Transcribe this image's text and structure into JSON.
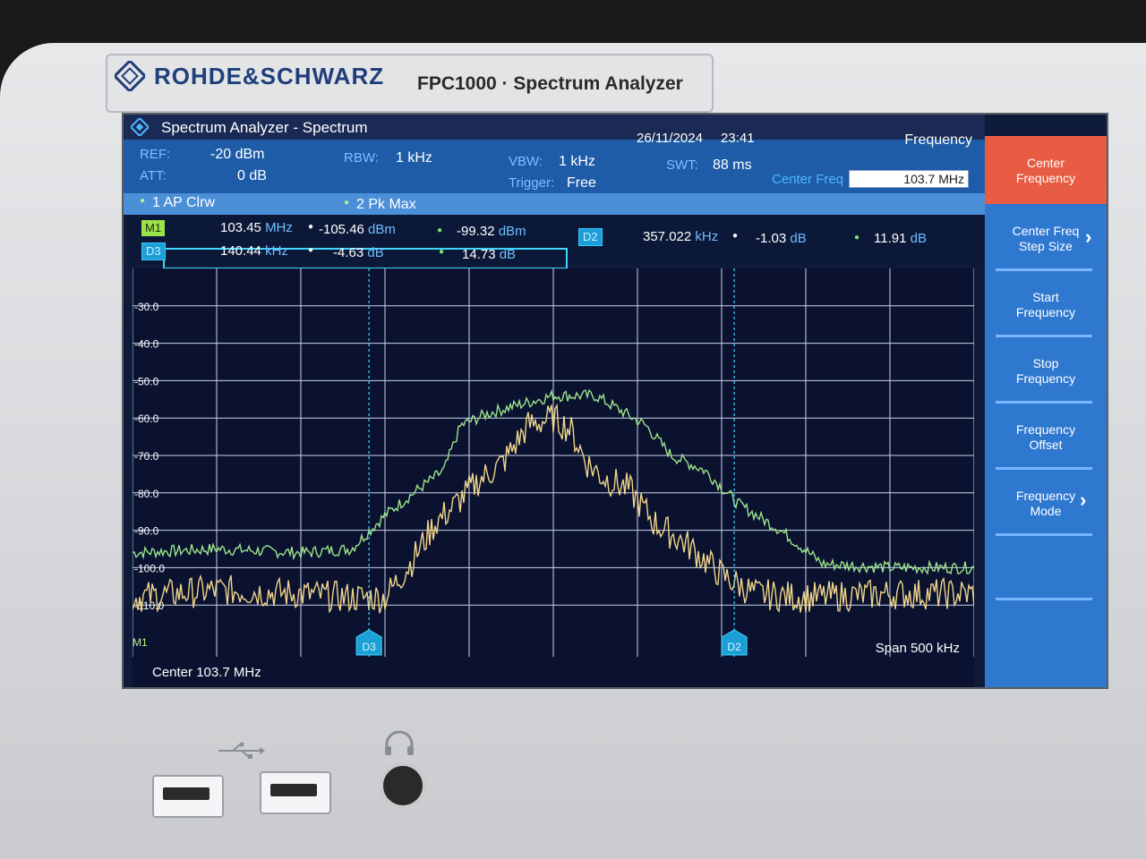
{
  "device": {
    "brand": "ROHDE&SCHWARZ",
    "model": "FPC1000 · Spectrum Analyzer"
  },
  "app": {
    "title": "Spectrum Analyzer - Spectrum",
    "date": "26/11/2024",
    "time": "23:41"
  },
  "params": {
    "ref_label": "REF:",
    "ref_value": "-20 dBm",
    "att_label": "ATT:",
    "att_value": "0 dB",
    "rbw_label": "RBW:",
    "rbw_value": "1 kHz",
    "vbw_label": "VBW:",
    "vbw_value": "1 kHz",
    "trigger_label": "Trigger:",
    "trigger_value": "Free",
    "swt_label": "SWT:",
    "swt_value": "88 ms"
  },
  "frequency_panel": {
    "heading": "Frequency",
    "center_freq_label": "Center Freq",
    "center_freq_value": "103.7 MHz"
  },
  "traces": {
    "t1": "1 AP  Clrw",
    "t2": "2 Pk  Max"
  },
  "markers": {
    "m1": {
      "tag": "M1",
      "freq": "103.45",
      "freq_unit": "MHz",
      "level": "-105.46",
      "level_unit": "dBm",
      "level2": "-99.32",
      "level2_unit": "dBm"
    },
    "d3": {
      "tag": "D3",
      "freq": "140.44",
      "freq_unit": "kHz",
      "level": "-4.63",
      "level_unit": "dB",
      "level2": "14.73",
      "level2_unit": "dB"
    },
    "d2": {
      "tag": "D2",
      "freq": "357.022",
      "freq_unit": "kHz",
      "level": "-1.03",
      "level_unit": "dB",
      "level2": "11.91",
      "level2_unit": "dB"
    }
  },
  "softkeys": [
    {
      "label_1": "Center",
      "label_2": "Frequency",
      "active": true
    },
    {
      "label_1": "Center Freq",
      "label_2": "Step Size",
      "chevron": "›"
    },
    {
      "label_1": "Start",
      "label_2": "Frequency"
    },
    {
      "label_1": "Stop",
      "label_2": "Frequency"
    },
    {
      "label_1": "Frequency",
      "label_2": "Offset"
    },
    {
      "label_1": "Frequency",
      "label_2": "Mode",
      "chevron": "›"
    }
  ],
  "plot_labels": {
    "center": "Center 103.7 MHz",
    "span": "Span 500 kHz",
    "m1_edge": "M1",
    "d3_flag": "D3",
    "d2_flag": "D2"
  },
  "chart_data": {
    "type": "line",
    "x_range_khz": [
      -250,
      250
    ],
    "ylim": [
      -120,
      -20
    ],
    "yticks": [
      "-30.0",
      "-40.0",
      "-50.0",
      "-60.0",
      "-70.0",
      "-80.0",
      "-90.0",
      "-100.0",
      "-110.0"
    ],
    "series": [
      {
        "color": "#9be38a",
        "x": [
          -250,
          -200,
          -150,
          -120,
          -100,
          -80,
          -65,
          -55,
          -40,
          -25,
          0,
          25,
          40,
          55,
          70,
          90,
          110,
          135,
          160,
          200,
          250
        ],
        "y": [
          -96,
          -95,
          -96,
          -95,
          -86,
          -79,
          -74,
          -62,
          -59,
          -57,
          -54,
          -54,
          -58,
          -62,
          -70,
          -74,
          -83,
          -90,
          -99,
          -100,
          -100
        ]
      },
      {
        "color": "#f0d48a",
        "x": [
          -250,
          -200,
          -150,
          -120,
          -100,
          -85,
          -70,
          -60,
          -45,
          -30,
          -15,
          0,
          10,
          20,
          30,
          45,
          60,
          80,
          100,
          120,
          150,
          200,
          250
        ],
        "y": [
          -108,
          -106,
          -107,
          -108,
          -108,
          -99,
          -88,
          -84,
          -77,
          -72,
          -62,
          -60,
          -63,
          -72,
          -76,
          -79,
          -88,
          -94,
          -102,
          -107,
          -108,
          -107,
          -107
        ]
      }
    ]
  },
  "colors": {
    "screen_bg": "#0a1230",
    "param_bar": "#1e5ca8",
    "softkey_active": "#e85c43",
    "softkey_bg": "#2f78d0",
    "trace1": "#9be38a",
    "trace2": "#f0d48a",
    "marker_line": "#3fd6ff"
  }
}
